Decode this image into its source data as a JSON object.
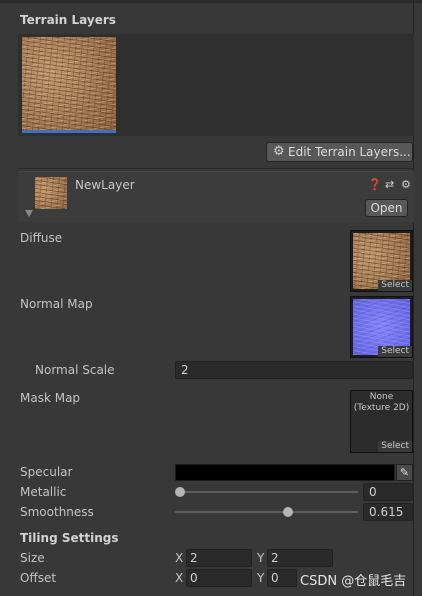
{
  "terrain_layers": {
    "title": "Terrain Layers",
    "edit_button": "Edit Terrain Layers..."
  },
  "layer": {
    "name": "NewLayer",
    "help_icon": "help-icon",
    "preset_icon": "preset-icon",
    "settings_icon": "gear-icon",
    "open_button": "Open"
  },
  "diffuse": {
    "label": "Diffuse",
    "select": "Select"
  },
  "normal_map": {
    "label": "Normal Map",
    "select": "Select"
  },
  "normal_scale": {
    "label": "Normal Scale",
    "value": "2"
  },
  "mask_map": {
    "label": "Mask Map",
    "none_line1": "None",
    "none_line2": "(Texture 2D)",
    "select": "Select"
  },
  "specular": {
    "label": "Specular",
    "color": "#000000"
  },
  "metallic": {
    "label": "Metallic",
    "value": "0",
    "fraction": 0.0
  },
  "smoothness": {
    "label": "Smoothness",
    "value": "0.615",
    "fraction": 0.615
  },
  "tiling": {
    "title": "Tiling Settings",
    "size_label": "Size",
    "size_x": "2",
    "size_y": "2",
    "offset_label": "Offset",
    "offset_x": "0",
    "offset_y": "0",
    "x_axis": "X",
    "y_axis": "Y"
  },
  "watermark": "CSDN @仓鼠毛吉",
  "colors": {
    "accent_line": "#3f6fc6"
  }
}
